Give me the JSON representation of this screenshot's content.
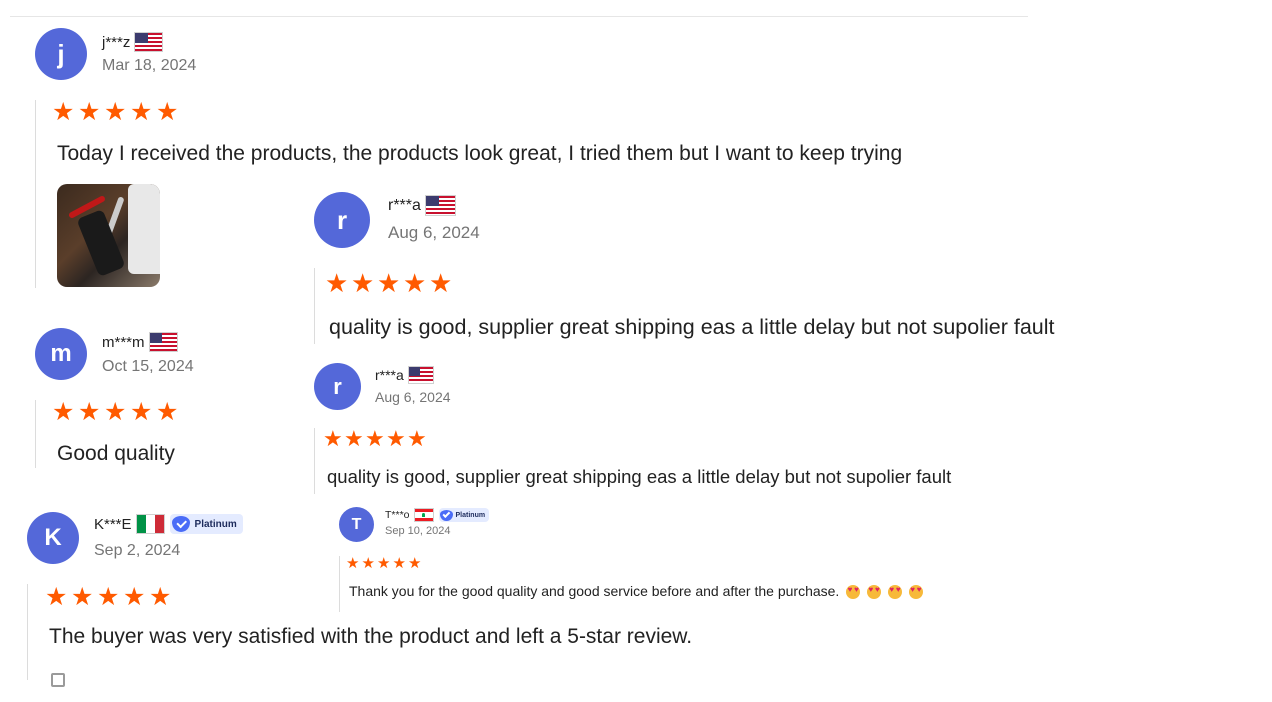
{
  "reviews": [
    {
      "initial": "j",
      "name": "j***z",
      "country": "US",
      "date": "Mar 18, 2024",
      "rating": 5,
      "text": "Today I received the products, the products look great, I tried them but I want to keep trying",
      "has_photo": true
    },
    {
      "initial": "r",
      "name": "r***a",
      "country": "US",
      "date": "Aug 6, 2024",
      "rating": 5,
      "text": "quality is good, supplier great shipping eas a little delay but not supolier fault"
    },
    {
      "initial": "m",
      "name": "m***m",
      "country": "US",
      "date": "Oct 15, 2024",
      "rating": 5,
      "text": "Good quality"
    },
    {
      "initial": "r",
      "name": "r***a",
      "country": "US",
      "date": "Aug 6, 2024",
      "rating": 5,
      "text": "quality is good, supplier great shipping eas a little delay but not supolier fault"
    },
    {
      "initial": "K",
      "name": "K***E",
      "country": "IT",
      "badge": "Platinum",
      "date": "Sep 2, 2024",
      "rating": 5,
      "text": "The buyer was very satisfied with the product and left a 5-star review."
    },
    {
      "initial": "T",
      "name": "T***o",
      "country": "LB",
      "badge": "Platinum",
      "date": "Sep 10, 2024",
      "rating": 5,
      "text": "Thank you for the good quality and good service before and after the purchase.",
      "emoji_count": 4
    }
  ],
  "colors": {
    "avatar": "#5468d9",
    "star": "#ff5a00",
    "date": "#757575",
    "badge_bg": "#e4ebff"
  },
  "icons": {
    "star": "star-icon",
    "verified": "platinum-gem-icon",
    "emoji": "heart-eyes-emoji-icon"
  }
}
